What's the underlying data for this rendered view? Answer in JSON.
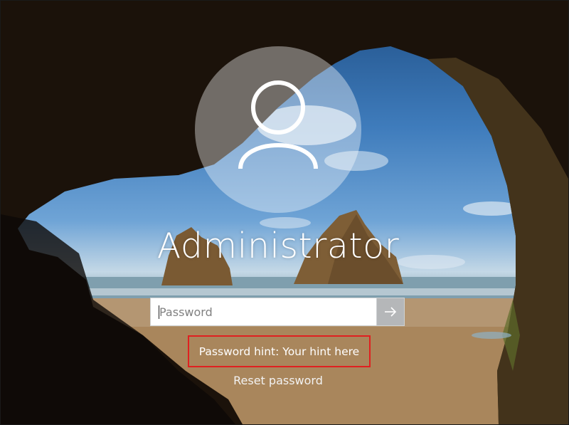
{
  "user": {
    "name": "Administrator"
  },
  "password": {
    "placeholder": "Password",
    "value": ""
  },
  "hint": {
    "text": "Password hint: Your hint here"
  },
  "reset": {
    "label": "Reset password"
  },
  "icons": {
    "avatar": "user-silhouette-icon",
    "submit": "arrow-right-icon"
  },
  "colors": {
    "highlight": "#e02020",
    "text": "#ffffff",
    "sky": "#3f7cbc",
    "sand": "#b89a76"
  }
}
